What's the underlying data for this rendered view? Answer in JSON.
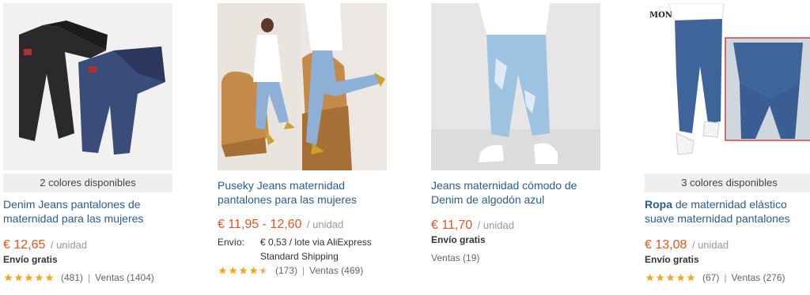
{
  "products": [
    {
      "colors_badge": "2 colores disponibles",
      "title": "Denim Jeans pantalones de maternidad para las mujeres",
      "price": "€ 12,65",
      "unit": "/ unidad",
      "shipping": "Envío gratis",
      "rating": 5,
      "reviews": "(481)",
      "separator": "|",
      "sales": "Ventas (1404)"
    },
    {
      "title": "Puseky Jeans maternidad pantalones para las mujeres",
      "price": "€ 11,95 - 12,60",
      "unit": "/ unidad",
      "shipping_label": "Envío:",
      "shipping_value": "€ 0,53 / lote via AliExpress Standard Shipping",
      "rating": 4.5,
      "reviews": "(173)",
      "separator": "|",
      "sales": "Ventas (469)"
    },
    {
      "title": "Jeans maternidad cómodo de Denim de algodón azul",
      "price": "€ 11,70",
      "unit": "/ unidad",
      "shipping": "Envío gratis",
      "sales": "Ventas (19)"
    },
    {
      "colors_badge": "3 colores disponibles",
      "title_bold": "Ropa",
      "title": " de maternidad elástico suave maternidad pantalones",
      "price": "€ 13,08",
      "unit": "/ unidad",
      "shipping": "Envío gratis",
      "rating": 5,
      "reviews": "(67)",
      "separator": "|",
      "sales": "Ventas (276)"
    }
  ],
  "image_text": "MONTH FIR",
  "colors": {
    "price": "#e8541c",
    "title": "#2a5d8f",
    "star": "#f5a623"
  }
}
